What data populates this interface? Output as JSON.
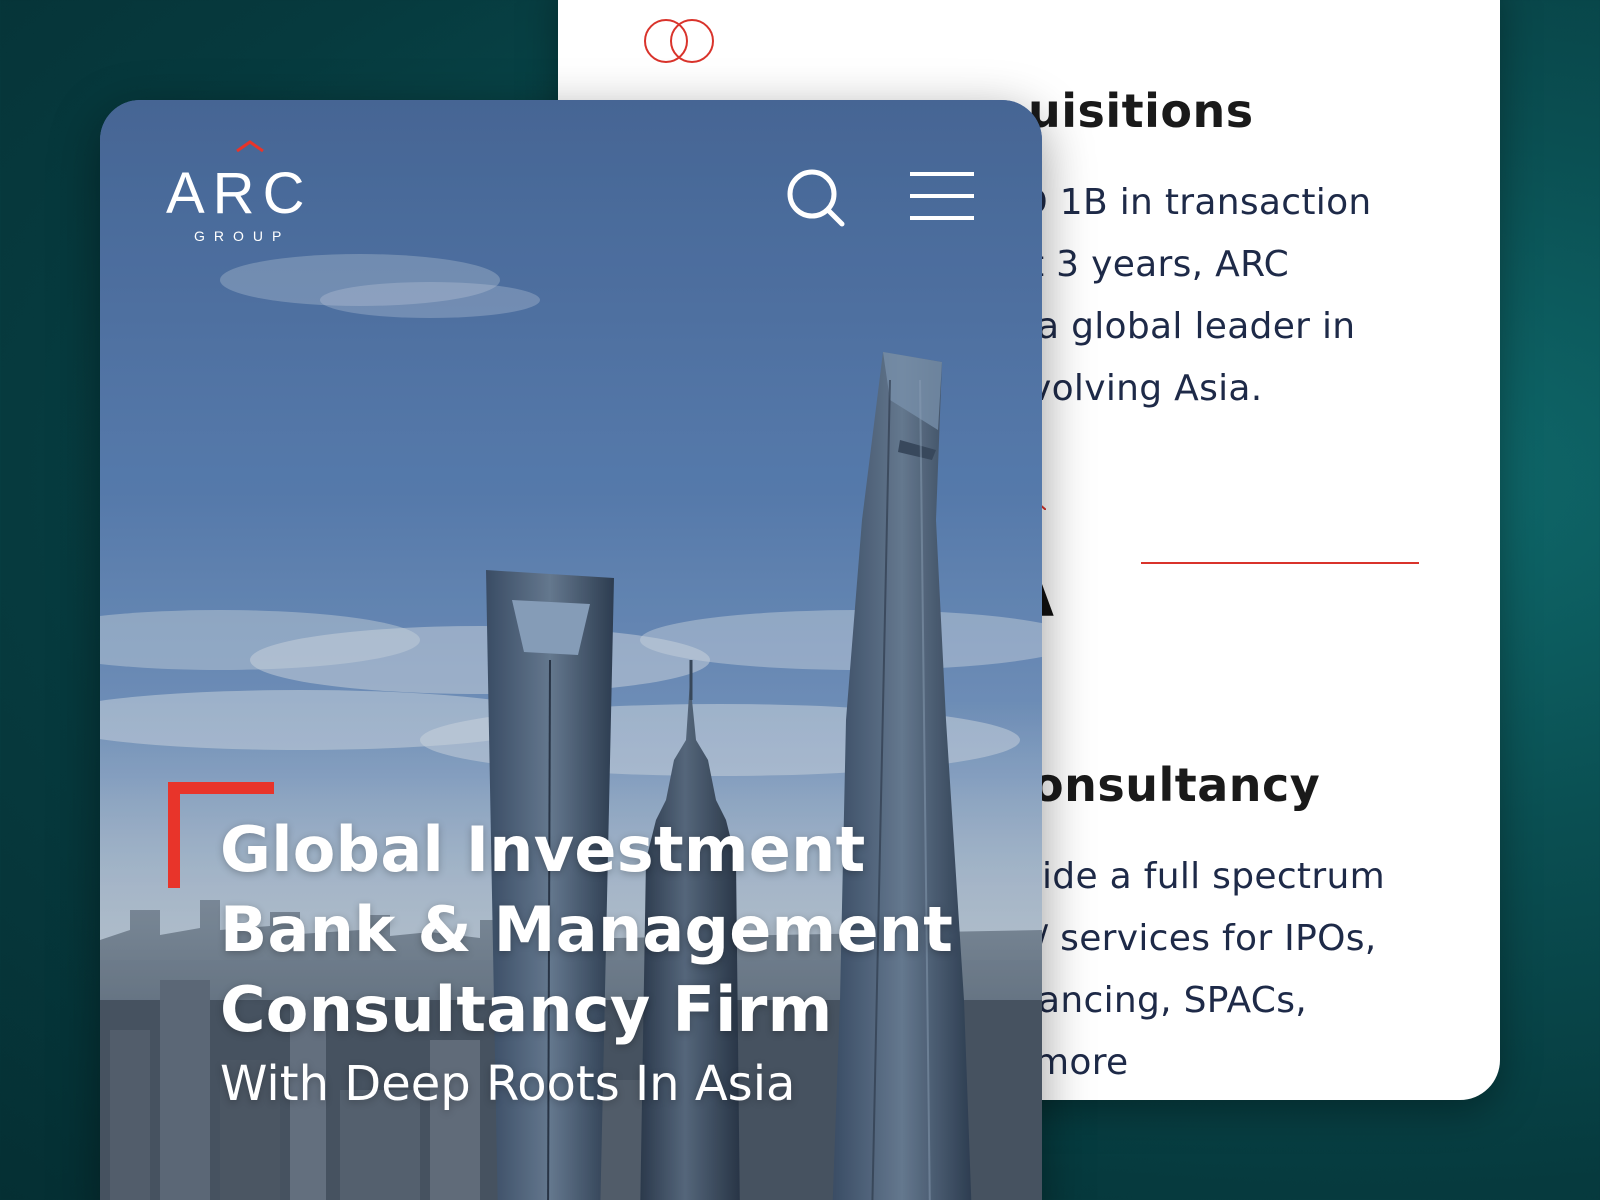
{
  "background": {
    "teal": "#0a4f52"
  },
  "back_card": {
    "sections": [
      {
        "heading": "uisitions",
        "lines": [
          "D 1B in transaction",
          "t 3 years, ARC",
          "a global leader in",
          "volving Asia."
        ]
      },
      {
        "heading": "onsultancy",
        "lines": [
          "ide a full spectrum",
          "/ services for IPOs,",
          "ancing, SPACs,",
          "more"
        ]
      }
    ],
    "fragment_letter": "A",
    "accent_color": "#d9332b"
  },
  "front_card": {
    "logo": {
      "wordmark": "ARC",
      "subtitle": "GROUP"
    },
    "search_icon": "search-icon",
    "menu_icon": "hamburger-menu-icon",
    "hero": {
      "title_lines": [
        "Global Investment",
        "Bank & Management",
        "Consultancy Firm"
      ],
      "subtitle": "With Deep Roots In Asia"
    },
    "accent_color": "#e8342a"
  }
}
